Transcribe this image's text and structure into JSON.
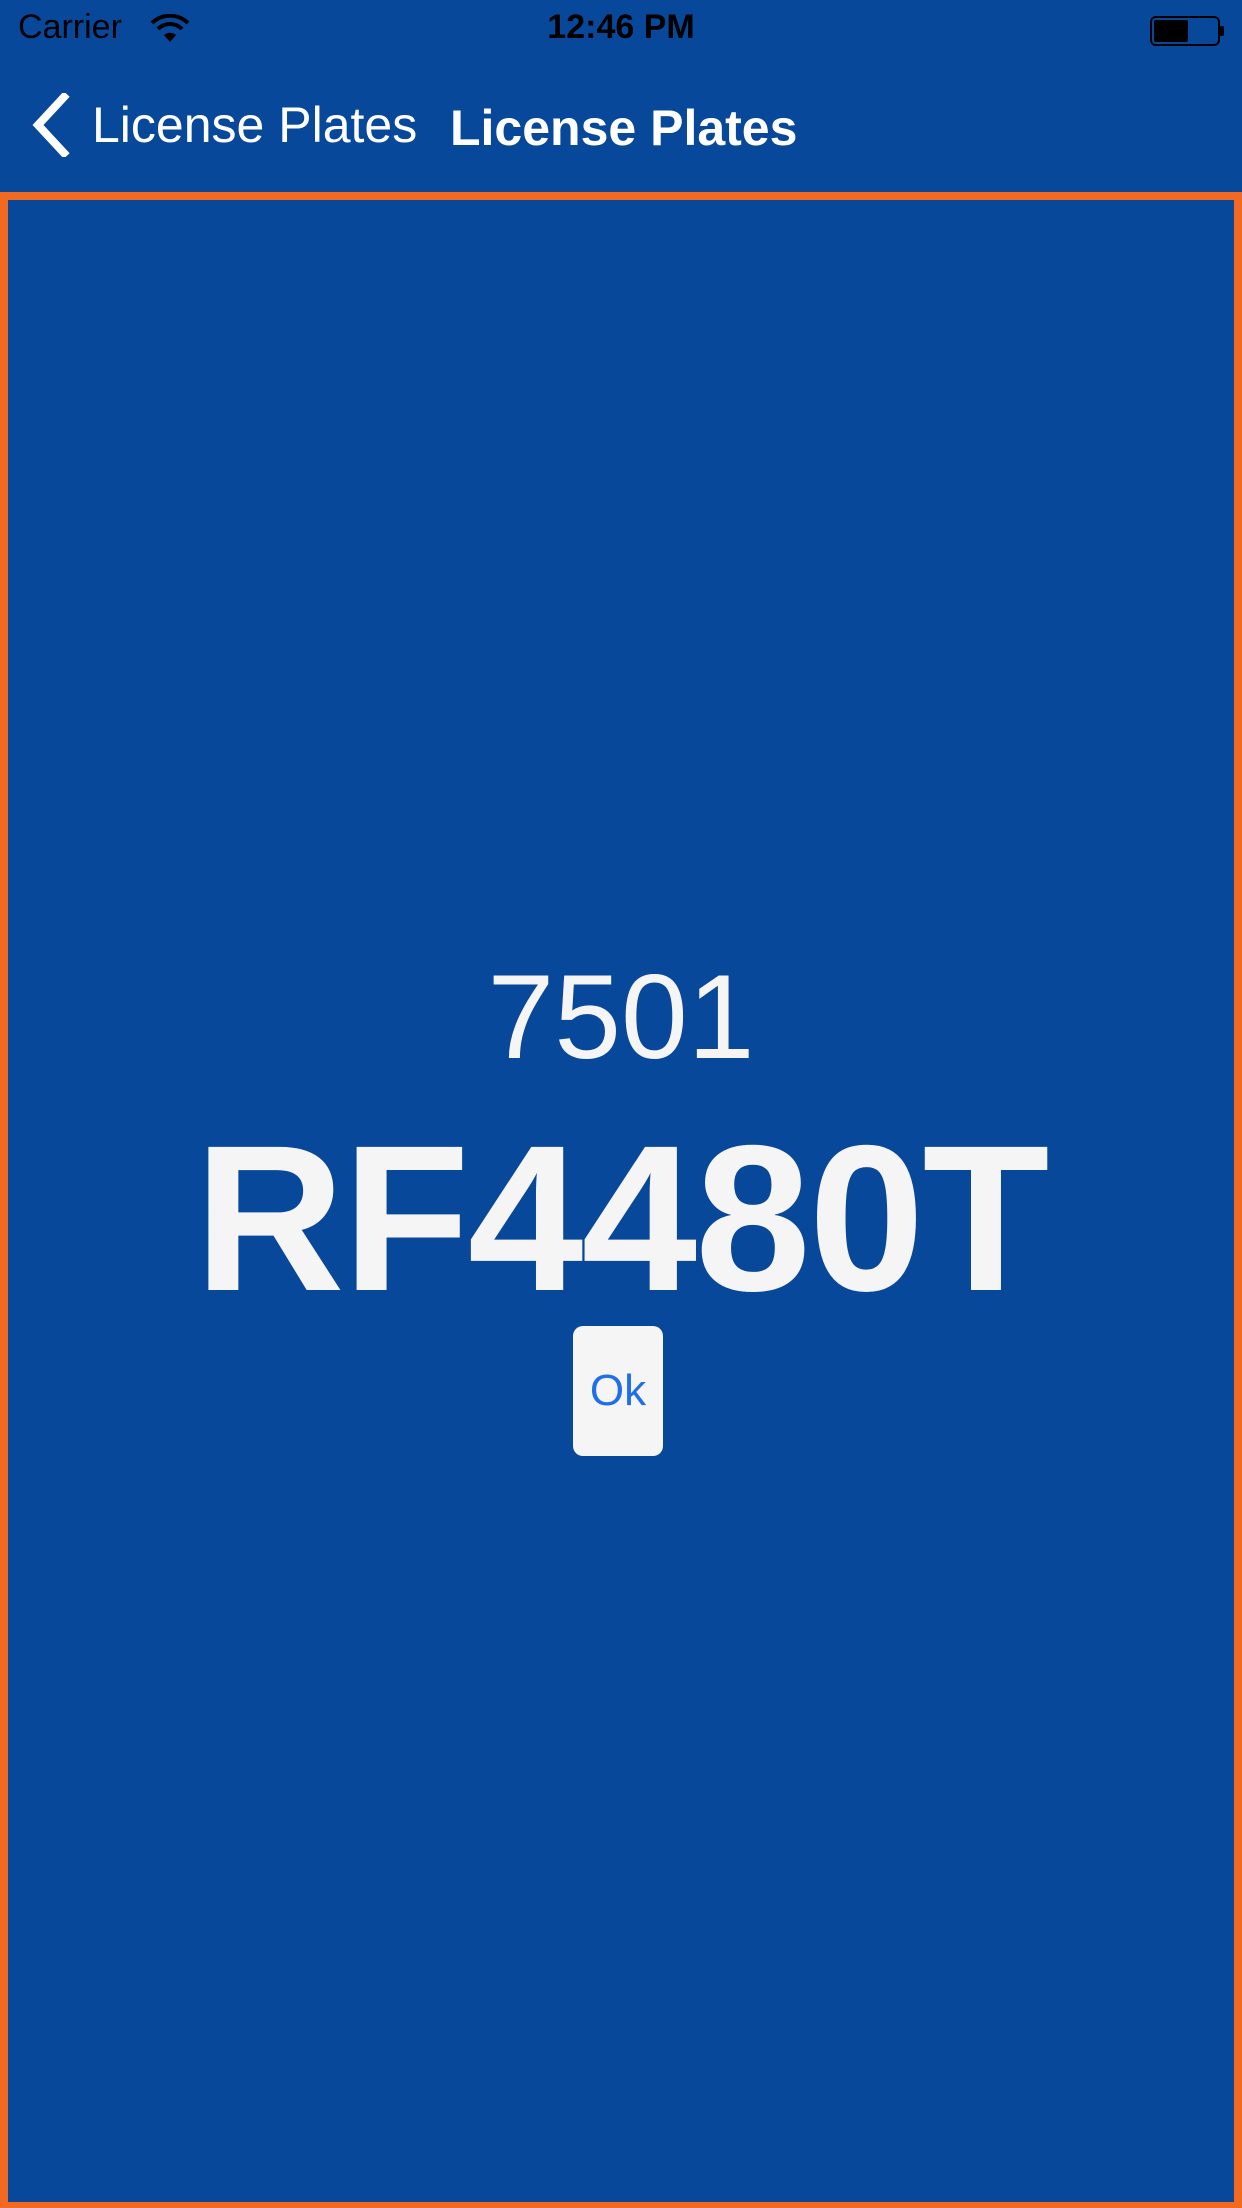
{
  "status_bar": {
    "carrier": "Carrier",
    "time": "12:46 PM",
    "wifi_icon": "wifi-icon",
    "battery_icon": "battery-icon",
    "battery_level": 0.55
  },
  "nav": {
    "back_label": "License Plates",
    "back_icon": "chevron-left-icon",
    "title": "License Plates"
  },
  "plate": {
    "number": "7501",
    "text": "RF4480T"
  },
  "actions": {
    "ok_label": "Ok"
  },
  "colors": {
    "background": "#08489b",
    "frame_border": "#f26a21",
    "text": "#f5f5f5",
    "button_text": "#1f6fe8"
  }
}
